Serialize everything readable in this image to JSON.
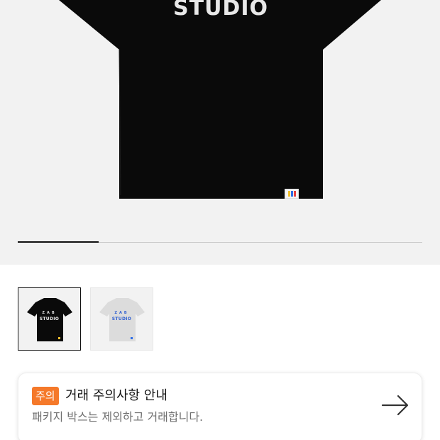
{
  "product": {
    "print_text": "STUDIO",
    "gallery": {
      "total_images": 5,
      "current_index": 1,
      "progress": 0.2
    }
  },
  "thumbnails": [
    {
      "color": "black",
      "selected": true,
      "print_top": "ZAB",
      "print_bottom": "STUDIO"
    },
    {
      "color": "white",
      "selected": false,
      "print_top": "ZAB",
      "print_bottom": "STUDIO"
    }
  ],
  "notice": {
    "badge": "주의",
    "title": "거래 주의사항 안내",
    "description": "패키지 박스는 제외하고 거래합니다.",
    "arrow_icon": "arrow-right-icon"
  },
  "colors": {
    "badge_bg": "#f5792a",
    "hero_bg": "#f2f2f2",
    "progress_fill": "#111111"
  }
}
